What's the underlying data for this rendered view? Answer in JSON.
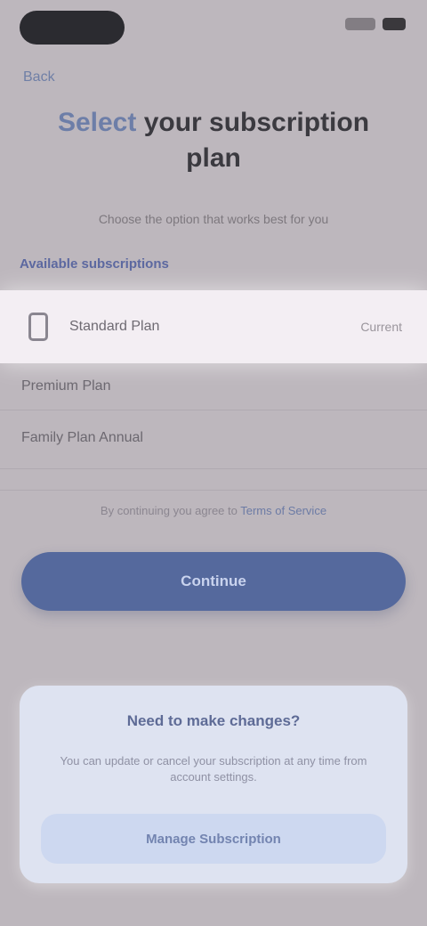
{
  "back_label": "Back",
  "header": {
    "title_accent": "Select",
    "title_rest": "your subscription plan",
    "subtitle": "Choose the option that works best for you"
  },
  "plans": {
    "section_label": "Available subscriptions",
    "selected": {
      "label": "Standard Plan",
      "status": "Current",
      "icon": "phone-icon"
    },
    "options": [
      {
        "label": "Premium Plan"
      },
      {
        "label": "Family Plan Annual"
      }
    ]
  },
  "terms": {
    "prefix": "By continuing you agree to ",
    "link": "Terms of Service"
  },
  "primary_button": "Continue",
  "card": {
    "title": "Need to make changes?",
    "text": "You can update or cancel your subscription at any time from account settings.",
    "button": "Manage Subscription"
  },
  "colors": {
    "accent": "#55699d",
    "card_bg": "#dee3f1",
    "selected_row_bg": "#f3eef3"
  }
}
